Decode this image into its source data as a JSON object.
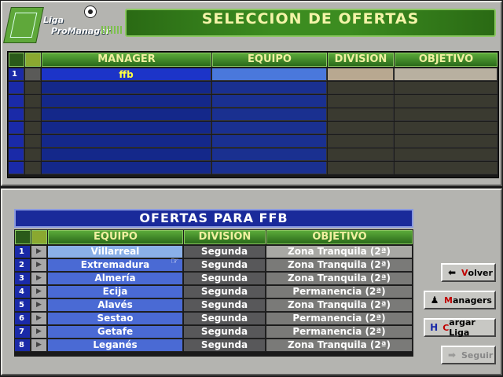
{
  "logo": {
    "line1": "Liga",
    "line2": "ProManager"
  },
  "header": {
    "title": "SELECCION DE OFERTAS"
  },
  "managers_table": {
    "headers": {
      "manager": "MANAGER",
      "team": "EQUIPO",
      "division": "DIVISION",
      "objective": "OBJETIVO"
    },
    "rows": [
      {
        "num": "1",
        "manager": "ffb",
        "team": "",
        "division": "",
        "objective": ""
      }
    ]
  },
  "offers": {
    "title": "OFERTAS PARA FFB",
    "headers": {
      "team": "EQUIPO",
      "division": "DIVISION",
      "objective": "OBJETIVO"
    },
    "rows": [
      {
        "num": "1",
        "team": "Villarreal",
        "division": "Segunda",
        "objective": "Zona Tranquila (2ª)"
      },
      {
        "num": "2",
        "team": "Extremadura",
        "division": "Segunda",
        "objective": "Zona Tranquila (2ª)"
      },
      {
        "num": "3",
        "team": "Almería",
        "division": "Segunda",
        "objective": "Zona Tranquila (2ª)"
      },
      {
        "num": "4",
        "team": "Ecija",
        "division": "Segunda",
        "objective": "Permanencia (2ª)"
      },
      {
        "num": "5",
        "team": "Alavés",
        "division": "Segunda",
        "objective": "Zona Tranquila (2ª)"
      },
      {
        "num": "6",
        "team": "Sestao",
        "division": "Segunda",
        "objective": "Permanencia (2ª)"
      },
      {
        "num": "7",
        "team": "Getafe",
        "division": "Segunda",
        "objective": "Permanencia (2ª)"
      },
      {
        "num": "8",
        "team": "Leganés",
        "division": "Segunda",
        "objective": "Zona Tranquila (2ª)"
      }
    ]
  },
  "buttons": {
    "volver": {
      "hotkey": "V",
      "rest": "olver"
    },
    "managers": {
      "hotkey": "M",
      "rest": "anagers"
    },
    "cargar": {
      "hotkey": "C",
      "rest": "argar Liga"
    },
    "seguir": {
      "label": "Seguir"
    }
  },
  "colors": {
    "accent_green": "#3c8c20",
    "title_yellow": "#f4f4a8",
    "team_blue": "#4a6ad4"
  }
}
